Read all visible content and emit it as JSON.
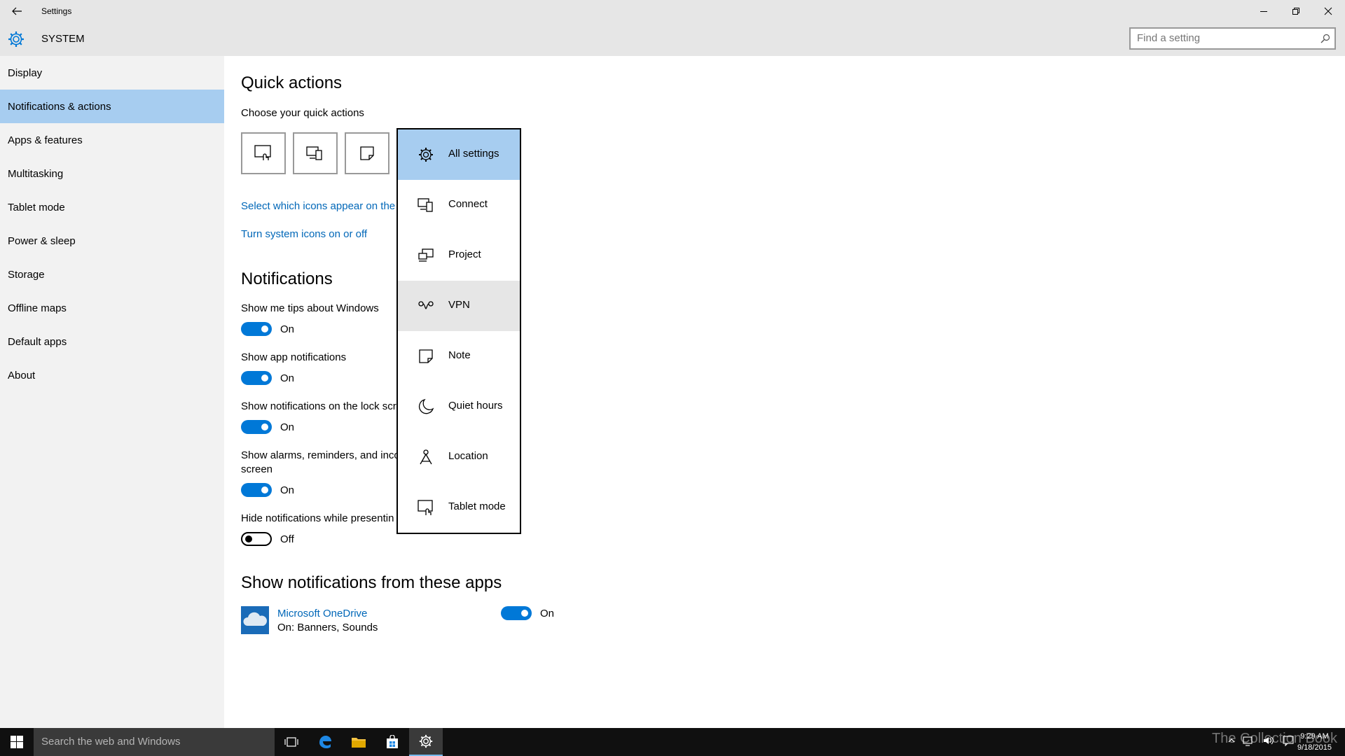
{
  "window": {
    "title": "Settings"
  },
  "header": {
    "title": "SYSTEM",
    "search_placeholder": "Find a setting"
  },
  "sidebar": {
    "items": [
      {
        "label": "Display"
      },
      {
        "label": "Notifications & actions"
      },
      {
        "label": "Apps & features"
      },
      {
        "label": "Multitasking"
      },
      {
        "label": "Tablet mode"
      },
      {
        "label": "Power & sleep"
      },
      {
        "label": "Storage"
      },
      {
        "label": "Offline maps"
      },
      {
        "label": "Default apps"
      },
      {
        "label": "About"
      }
    ],
    "active_index": 1
  },
  "quick_actions": {
    "heading": "Quick actions",
    "subheading": "Choose your quick actions",
    "link_icons": "Select which icons appear on the",
    "link_system_icons": "Turn system icons on or off"
  },
  "notifications": {
    "heading": "Notifications",
    "settings": [
      {
        "label": "Show me tips about Windows",
        "state": "On"
      },
      {
        "label": "Show app notifications",
        "state": "On"
      },
      {
        "label": "Show notifications on the lock scr",
        "state": "On"
      },
      {
        "label": "Show alarms, reminders, and inco",
        "label2": "screen",
        "state": "On"
      },
      {
        "label": "Hide notifications while presentin",
        "state": "Off"
      }
    ]
  },
  "apps_section": {
    "heading": "Show notifications from these apps",
    "apps": [
      {
        "name": "Microsoft OneDrive",
        "detail": "On: Banners, Sounds",
        "state": "On"
      }
    ]
  },
  "flyout": {
    "items": [
      {
        "label": "All settings",
        "icon": "gear-icon"
      },
      {
        "label": "Connect",
        "icon": "connect-icon"
      },
      {
        "label": "Project",
        "icon": "project-icon"
      },
      {
        "label": "VPN",
        "icon": "vpn-icon"
      },
      {
        "label": "Note",
        "icon": "note-icon"
      },
      {
        "label": "Quiet hours",
        "icon": "moon-icon"
      },
      {
        "label": "Location",
        "icon": "location-icon"
      },
      {
        "label": "Tablet mode",
        "icon": "tablet-mode-icon"
      }
    ],
    "selected_index": 0,
    "hover_index": 3
  },
  "taskbar": {
    "search_placeholder": "Search the web and Windows",
    "time": "9:29 AM",
    "date": "9/18/2015",
    "watermark": "The Collection Book"
  },
  "colors": {
    "accent": "#0078d7",
    "selection": "#a7cdf0",
    "link": "#0067b8"
  }
}
